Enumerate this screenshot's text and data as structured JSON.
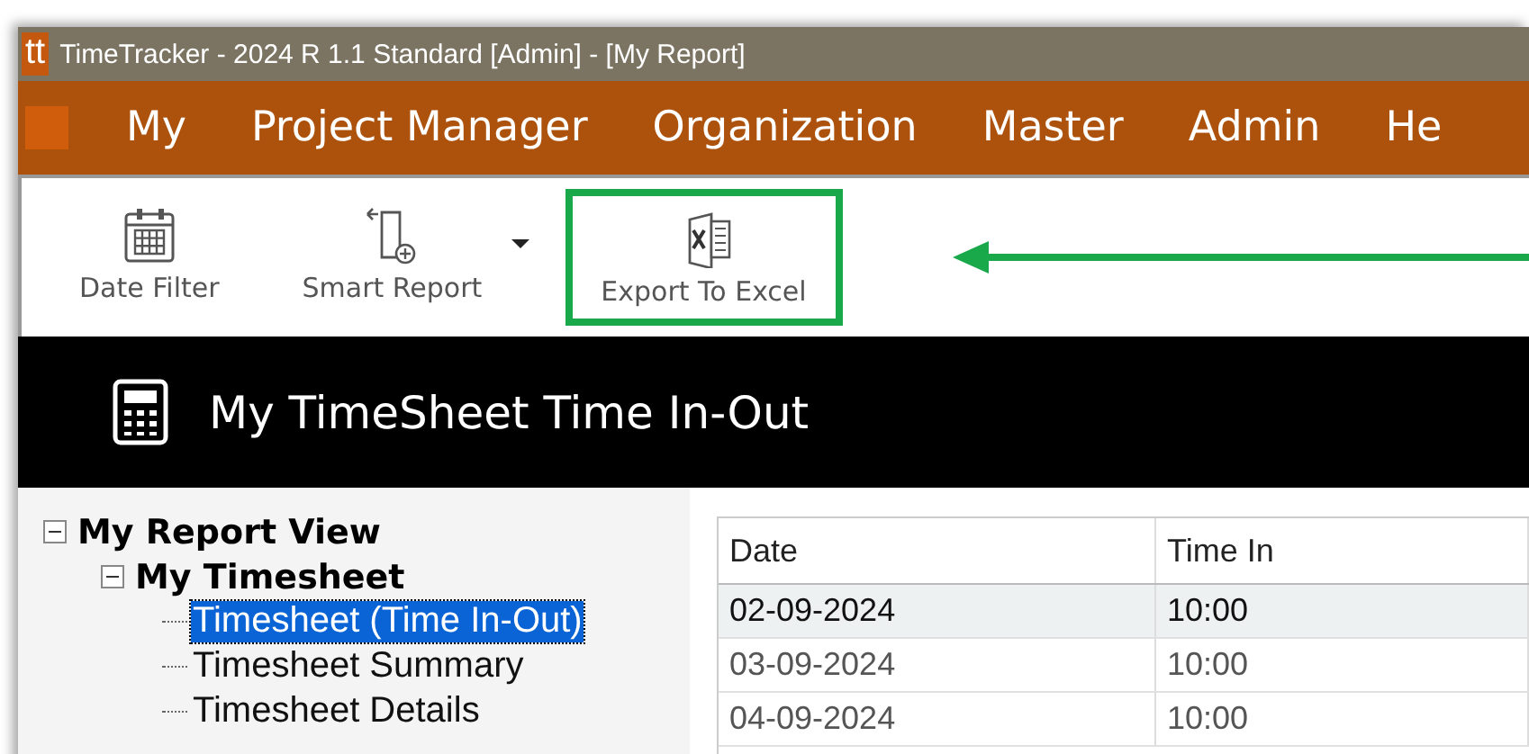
{
  "window": {
    "app_icon": "tt",
    "title": "TimeTracker - 2024 R 1.1 Standard [Admin] - [My Report]"
  },
  "menu": [
    "My",
    "Project Manager",
    "Organization",
    "Master",
    "Admin",
    "He"
  ],
  "toolbar": [
    {
      "kind": "calendar",
      "label": "Date Filter",
      "dropdown": false,
      "highlighted": false
    },
    {
      "kind": "report",
      "label": "Smart Report",
      "dropdown": true,
      "highlighted": false
    },
    {
      "kind": "excel",
      "label": "Export To Excel",
      "dropdown": false,
      "highlighted": true
    }
  ],
  "header": {
    "title": "My TimeSheet Time In-Out"
  },
  "tree": [
    {
      "label": "My Report View",
      "expanded": true,
      "selected": false,
      "children": [
        {
          "label": "My Timesheet",
          "expanded": true,
          "selected": false,
          "children": [
            {
              "label": "Timesheet (Time In-Out)",
              "selected": true
            },
            {
              "label": "Timesheet Summary",
              "selected": false
            },
            {
              "label": "Timesheet Details",
              "selected": false
            }
          ]
        }
      ]
    }
  ],
  "table": {
    "columns": [
      "Date",
      "Time In"
    ],
    "rows": [
      {
        "cells": [
          "02-09-2024",
          "10:00"
        ],
        "selected": true
      },
      {
        "cells": [
          "03-09-2024",
          "10:00"
        ],
        "selected": false
      },
      {
        "cells": [
          "04-09-2024",
          "10:00"
        ],
        "selected": false
      }
    ]
  }
}
